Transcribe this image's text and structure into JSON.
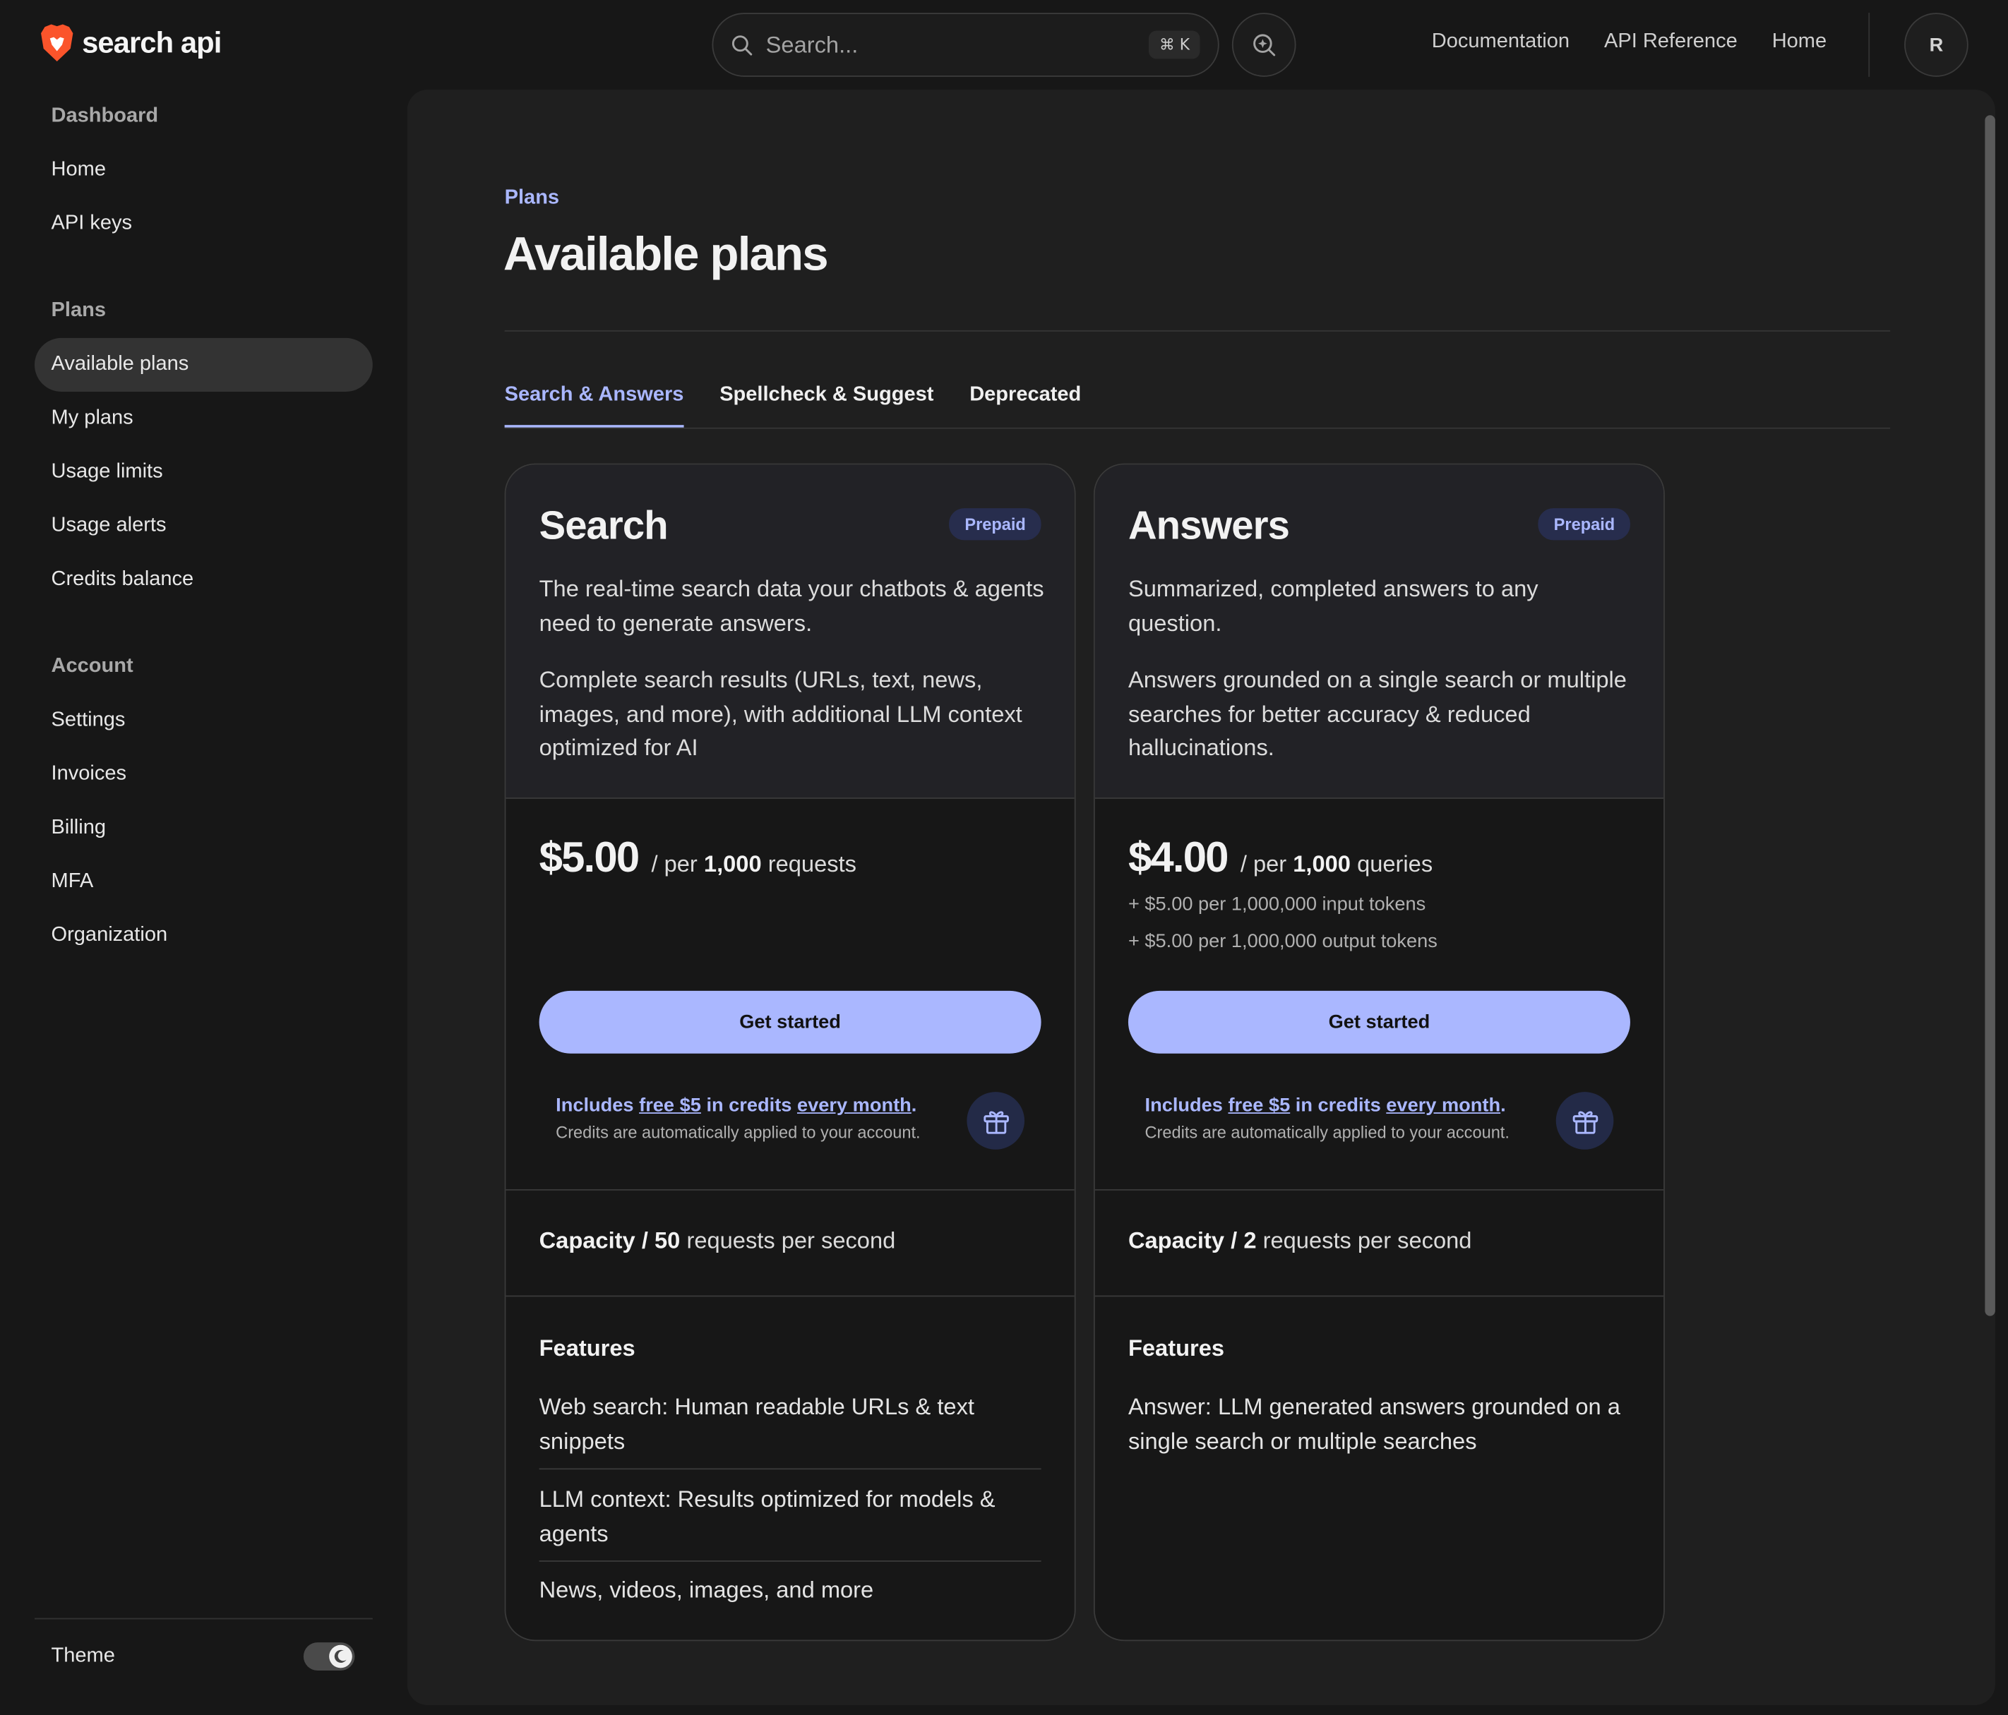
{
  "brand": {
    "name": "search api"
  },
  "header": {
    "search_placeholder": "Search...",
    "search_shortcut": "⌘ K",
    "links": [
      "Documentation",
      "API Reference",
      "Home"
    ],
    "avatar_initial": "R"
  },
  "sidebar": {
    "sections": [
      {
        "title": "Dashboard",
        "items": [
          "Home",
          "API keys"
        ]
      },
      {
        "title": "Plans",
        "items": [
          "Available plans",
          "My plans",
          "Usage limits",
          "Usage alerts",
          "Credits balance"
        ]
      },
      {
        "title": "Account",
        "items": [
          "Settings",
          "Invoices",
          "Billing",
          "MFA",
          "Organization"
        ]
      }
    ],
    "active_item": "Available plans",
    "theme_label": "Theme"
  },
  "main": {
    "breadcrumb": "Plans",
    "title": "Available plans",
    "tabs": [
      "Search & Answers",
      "Spellcheck & Suggest",
      "Deprecated"
    ],
    "active_tab": "Search & Answers"
  },
  "cards": [
    {
      "name": "Search",
      "badge": "Prepaid",
      "desc1": "The real-time search data your chatbots & agents need to generate answers.",
      "desc2": "Complete search results (URLs, text, news, images, and more), with additional LLM context optimized for AI",
      "price": "$5.00",
      "per": "/ per",
      "unit_count": "1,000",
      "unit": "requests",
      "extras": [],
      "cta": "Get started",
      "credits": {
        "includes": "Includes",
        "free": "free $5",
        "in_credits": "in credits",
        "every_month": "every month",
        "note": "Credits are automatically applied to your account."
      },
      "capacity_label": "Capacity",
      "capacity_value": "50",
      "capacity_unit": "requests per second",
      "features_title": "Features",
      "features": [
        "Web search: Human readable URLs & text snippets",
        "LLM context: Results optimized for models & agents",
        "News, videos, images, and more"
      ]
    },
    {
      "name": "Answers",
      "badge": "Prepaid",
      "desc1": "Summarized, completed answers to any question.",
      "desc2": "Answers grounded on a single search or multiple searches for better accuracy & reduced hallucinations.",
      "price": "$4.00",
      "per": "/ per",
      "unit_count": "1,000",
      "unit": "queries",
      "extras": [
        "+ $5.00 per 1,000,000 input tokens",
        "+ $5.00 per 1,000,000 output tokens"
      ],
      "cta": "Get started",
      "credits": {
        "includes": "Includes",
        "free": "free $5",
        "in_credits": "in credits",
        "every_month": "every month",
        "note": "Credits are automatically applied to your account."
      },
      "capacity_label": "Capacity",
      "capacity_value": "2",
      "capacity_unit": "requests per second",
      "features_title": "Features",
      "features": [
        "Answer: LLM generated answers grounded on a single search or multiple searches"
      ]
    }
  ],
  "colors": {
    "accent": "#aab7ff",
    "background": "#171717",
    "panel": "#1f1f1f",
    "brand": "#fb542b"
  }
}
